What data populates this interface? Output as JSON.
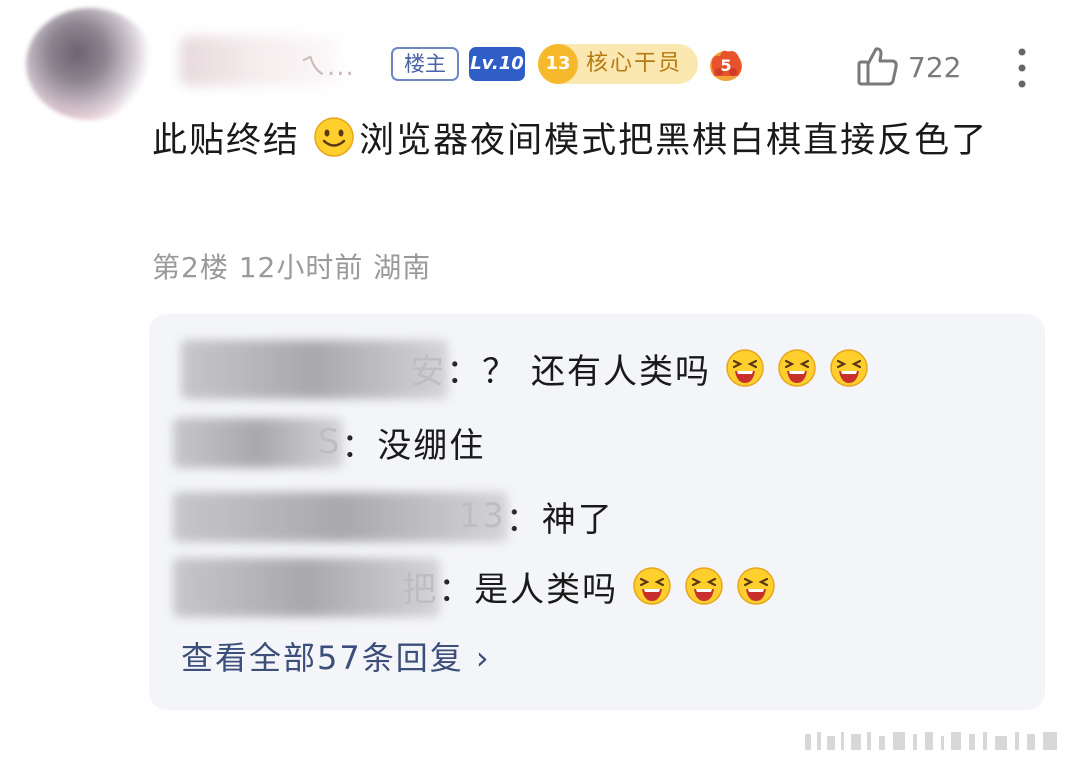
{
  "post": {
    "author_name_visible": "ㄟ...",
    "badges": {
      "host": "楼主",
      "level": "Lv.10",
      "core_level": "13",
      "core_title": "核心干员",
      "fire_level": "5"
    },
    "likes": "722",
    "content_part1": "此贴终结",
    "content_emoji": "smile-emoji",
    "content_part2": "浏览器夜间模式把黑棋白棋直接反色了",
    "floor": "第2楼",
    "time": "12小时前",
    "location": "湖南"
  },
  "replies": [
    {
      "name_tail": "安",
      "text": "：？ 还有人类吗",
      "emojis": 3
    },
    {
      "name_tail": "S",
      "text": "：没绷住",
      "emojis": 0
    },
    {
      "name_tail": "13",
      "text": "：神了",
      "emojis": 0
    },
    {
      "name_tail": "把",
      "text": "：是人类吗",
      "emojis": 3
    }
  ],
  "view_all": "查看全部57条回复 ›",
  "colors": {
    "host_badge": "#4a63a8",
    "level_badge": "#2f5ec7",
    "core_badge_bg": "#fbe7b0",
    "core_badge_text": "#b77a12",
    "meta_text": "#9a9a9a",
    "card_bg": "#f4f5f8",
    "link": "#3b4f7a"
  }
}
